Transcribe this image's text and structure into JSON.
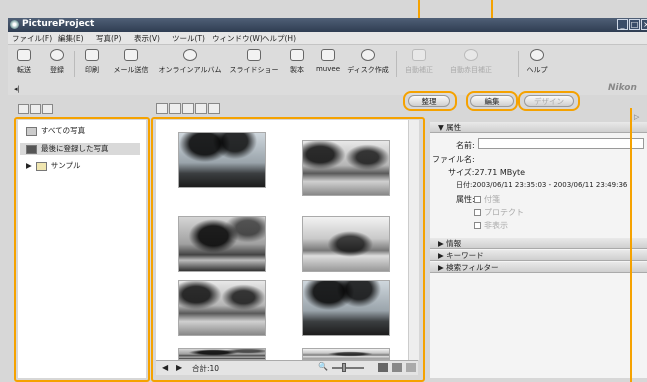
{
  "window": {
    "title": "PictureProject"
  },
  "menu": [
    "ファイル(F)",
    "編集(E)",
    "写真(P)",
    "表示(V)",
    "ツール(T)",
    "ウィンドウ(W)",
    "ヘルプ(H)"
  ],
  "toolbar": [
    {
      "label": "転送",
      "icon": "transfer-icon"
    },
    {
      "label": "登録",
      "icon": "register-icon"
    },
    {
      "label": "印刷",
      "icon": "print-icon"
    },
    {
      "label": "メール送信",
      "icon": "mail-icon"
    },
    {
      "label": "オンラインアルバム",
      "icon": "globe-icon"
    },
    {
      "label": "スライドショー",
      "icon": "slideshow-icon"
    },
    {
      "label": "製本",
      "icon": "book-icon"
    },
    {
      "label": "muvee",
      "icon": "muvee-icon"
    },
    {
      "label": "ディスク作成",
      "icon": "disc-icon"
    },
    {
      "label": "自動補正",
      "icon": "auto-correct-icon"
    },
    {
      "label": "自動赤目補正",
      "icon": "red-eye-icon"
    },
    {
      "label": "ヘルプ",
      "icon": "help-icon"
    }
  ],
  "modes": {
    "organize": "整理",
    "edit": "編集",
    "design": "デザイン"
  },
  "brand": "Nikon",
  "tree": {
    "all": "すべての写真",
    "recent": "最後に登録した写真",
    "sample": "サンプル"
  },
  "status": {
    "count": "合計:10"
  },
  "props": {
    "section": "属性",
    "name_label": "名前:",
    "file_label": "ファイル名:",
    "size": "サイズ:27.71 MByte",
    "date": "日付:2003/06/11 23:35:03 - 2003/06/11 23:49:36",
    "attr_label": "属性:",
    "attrs": [
      "付箋",
      "プロテクト",
      "非表示"
    ],
    "sections": [
      "情報",
      "キーワード",
      "検索フィルター"
    ]
  },
  "colors": {
    "highlight": "#f5a200",
    "titlebar": "#3a4a60"
  }
}
